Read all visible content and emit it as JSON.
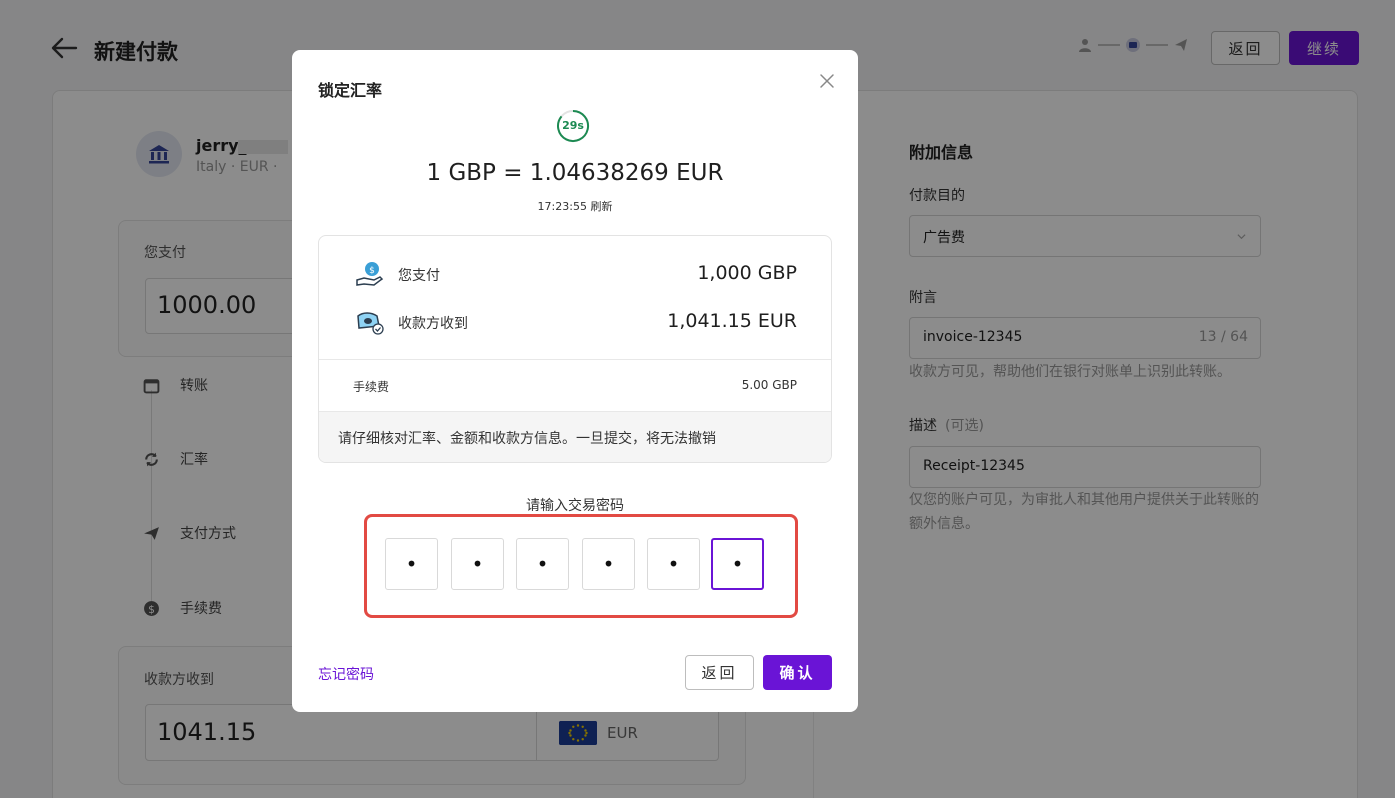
{
  "header": {
    "title": "新建付款",
    "back_label": "返回",
    "continue_label": "继续"
  },
  "payee": {
    "name": "jerry_",
    "meta": "Italy · EUR ·"
  },
  "you_pay": {
    "label": "您支付",
    "value": "1000.00"
  },
  "timeline": [
    {
      "label": "转账",
      "icon": "calendar-icon"
    },
    {
      "label": "汇率",
      "icon": "exchange-icon"
    },
    {
      "label": "支付方式",
      "icon": "send-icon"
    },
    {
      "label": "手续费",
      "icon": "dollar-icon"
    }
  ],
  "receive": {
    "label": "收款方收到",
    "value": "1041.15",
    "currency": "EUR"
  },
  "extra": {
    "title": "附加信息",
    "purpose_label": "付款目的",
    "purpose_value": "广告费",
    "note_label": "附言",
    "note_value": "invoice-12345",
    "note_count": "13 / 64",
    "note_hint": "收款方可见，帮助他们在银行对账单上识别此转账。",
    "desc_label": "描述",
    "desc_optional": "(可选)",
    "desc_value": "Receipt-12345",
    "desc_hint": "仅您的账户可见，为审批人和其他用户提供关于此转账的额外信息。"
  },
  "modal": {
    "title": "锁定汇率",
    "timer": "29s",
    "rate": "1 GBP = 1.04638269 EUR",
    "refresh": "17:23:55 刷新",
    "you_pay_label": "您支付",
    "you_pay_value": "1,000 GBP",
    "receive_label": "收款方收到",
    "receive_value": "1,041.15 EUR",
    "fee_label": "手续费",
    "fee_value": "5.00 GBP",
    "warning": "请仔细核对汇率、金额和收款方信息。一旦提交，将无法撤销",
    "password_label": "请输入交易密码",
    "password_digits": [
      "•",
      "•",
      "•",
      "•",
      "•",
      "•"
    ],
    "forgot_label": "忘记密码",
    "back_label": "返回",
    "confirm_label": "确认"
  },
  "colors": {
    "accent": "#6a14d6",
    "highlight": "#e24a43",
    "timer": "#1c8a52"
  }
}
